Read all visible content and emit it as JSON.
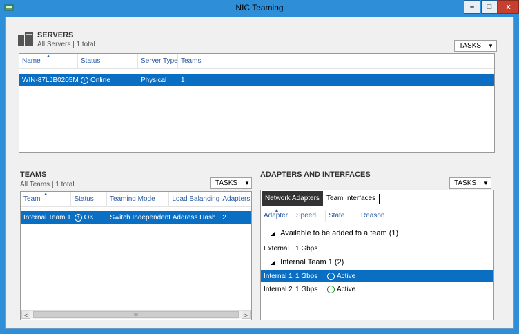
{
  "window": {
    "title": "NIC Teaming",
    "min_label": "–",
    "max_label": "□",
    "close_label": "x"
  },
  "colors": {
    "accent": "#0a6fc2",
    "titlebar": "#2e8ed8",
    "close": "#c7402f",
    "ok": "#1e8c1e"
  },
  "servers": {
    "title": "SERVERS",
    "subtitle": "All Servers | 1 total",
    "tasks_label": "TASKS",
    "columns": [
      "Name",
      "Status",
      "Server Type",
      "Teams"
    ],
    "rows": [
      {
        "name": "WIN-87LJB0205MI",
        "status": "Online",
        "server_type": "Physical",
        "teams": "1"
      }
    ]
  },
  "teams": {
    "title": "TEAMS",
    "subtitle": "All Teams | 1 total",
    "tasks_label": "TASKS",
    "columns": [
      "Team",
      "Status",
      "Teaming Mode",
      "Load Balancing",
      "Adapters"
    ],
    "rows": [
      {
        "team": "Internal Team 1",
        "status": "OK",
        "mode": "Switch Independent",
        "load_balancing": "Address Hash",
        "adapters": "2"
      }
    ],
    "scroll_left": "<",
    "scroll_right": ">",
    "scroll_grip": "III"
  },
  "adapters": {
    "title": "ADAPTERS AND INTERFACES",
    "tasks_label": "TASKS",
    "tabs": [
      "Network Adapters",
      "Team Interfaces"
    ],
    "columns": [
      "Adapter",
      "Speed",
      "State",
      "Reason"
    ],
    "group_available": "Available to be added to a team (1)",
    "available_rows": [
      {
        "adapter": "External",
        "speed": "1 Gbps",
        "state": ""
      }
    ],
    "group_team": "Internal Team 1 (2)",
    "team_rows": [
      {
        "adapter": "Internal 1",
        "speed": "1 Gbps",
        "state": "Active"
      },
      {
        "adapter": "Internal 2",
        "speed": "1 Gbps",
        "state": "Active"
      }
    ]
  }
}
